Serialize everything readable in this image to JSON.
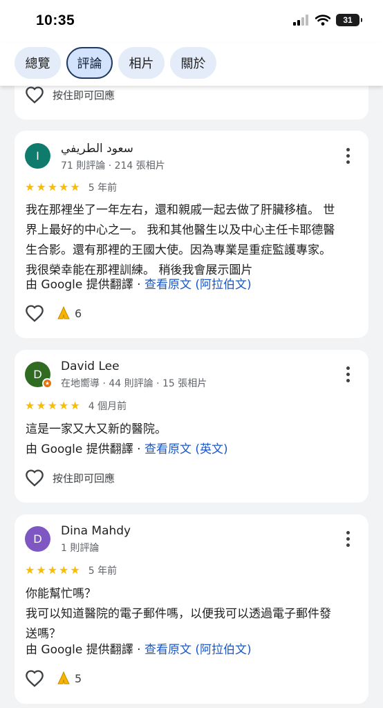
{
  "status": {
    "time": "10:35",
    "battery": "31"
  },
  "tabs": [
    {
      "label": "總覽"
    },
    {
      "label": "評論"
    },
    {
      "label": "相片"
    },
    {
      "label": "關於"
    }
  ],
  "prev": {
    "reply_hint": "按住即可回應"
  },
  "reviews": [
    {
      "name": "سعود الطريفي",
      "avatar": "I",
      "avatar_color": "#0f7b6c",
      "meta": "71 則評論 · 214 張相片",
      "rating": 5,
      "date": "5 年前",
      "lines": [
        "我在那裡坐了一年左右，還和親戚一起去做了肝臟移植。 世",
        "界上最好的中心之一。 我和其他醫生以及中心主任卡耶德醫",
        "生合影。還有那裡的王國大使。因為專業是重症監護專家。",
        "我很榮幸能在那裡訓練。 稍後我會展示圖片"
      ],
      "translated_by": "由 Google 提供翻譯 · ",
      "original_link": "查看原文 (阿拉伯文)",
      "reactions": "6"
    },
    {
      "name": "David Lee",
      "avatar": "D",
      "avatar_color": "#2f6b21",
      "local_guide": "★",
      "meta": "在地嚮導 · 44 則評論 · 15 張相片",
      "rating": 5,
      "date": "4 個月前",
      "lines": [
        "這是一家又大又新的醫院。"
      ],
      "translated_by": "由 Google 提供翻譯 · ",
      "original_link": "查看原文 (英文)",
      "reply_hint": "按住即可回應"
    },
    {
      "name": "Dina Mahdy",
      "avatar": "D",
      "avatar_color": "#7e57c2",
      "meta": "1 則評論",
      "rating": 5,
      "date": "5 年前",
      "lines": [
        "你能幫忙嗎？",
        "我可以知道醫院的電子郵件嗎，以便我可以透過電子郵件發",
        "送嗎？"
      ],
      "translated_by": "由 Google 提供翻譯 · ",
      "original_link": "查看原文 (阿拉伯文)",
      "reactions": "5"
    }
  ]
}
